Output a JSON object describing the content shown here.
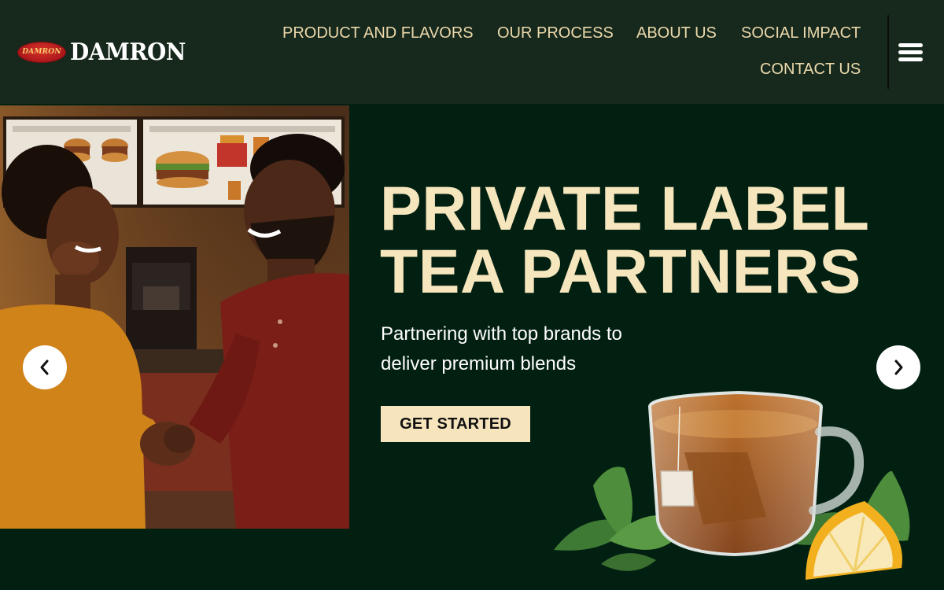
{
  "brand": {
    "badge_text": "DAMRON",
    "wordmark": "DAMRON"
  },
  "nav": {
    "items": [
      {
        "label": "PRODUCT AND FLAVORS"
      },
      {
        "label": "OUR PROCESS"
      },
      {
        "label": "ABOUT US"
      },
      {
        "label": "SOCIAL IMPACT"
      },
      {
        "label": "CONTACT US"
      }
    ],
    "menu_icon": "hamburger-icon"
  },
  "hero": {
    "headline_line1": "PRIVATE LABEL",
    "headline_line2": "TEA PARTNERS",
    "subtitle_line1": "Partnering with top brands to",
    "subtitle_line2": "deliver premium blends",
    "cta_label": "GET STARTED",
    "prev_icon": "chevron-left-icon",
    "next_icon": "chevron-right-icon"
  },
  "colors": {
    "header_bg": "#17291c",
    "hero_bg": "#022011",
    "accent_cream": "#f6e6bd",
    "nav_text": "#ecd9ac"
  }
}
